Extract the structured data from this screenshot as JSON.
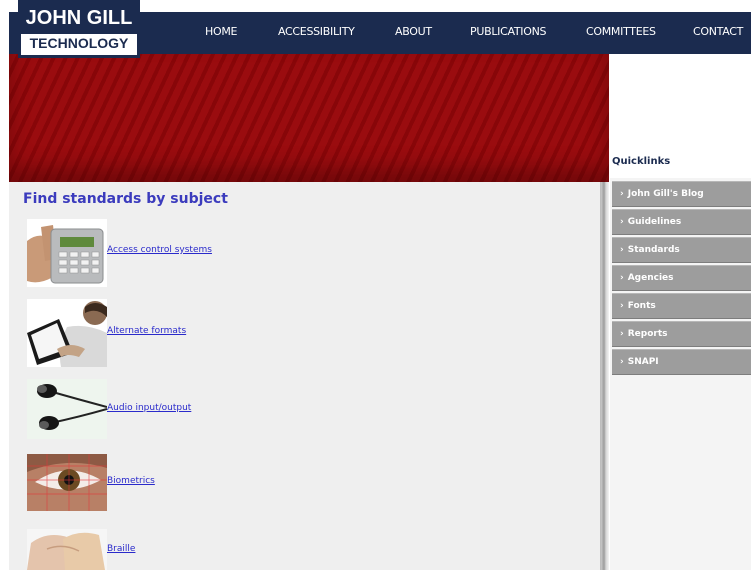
{
  "logo": {
    "line1": "JOHN GILL",
    "line2": "TECHNOLOGY"
  },
  "nav": {
    "items": [
      {
        "label": "HOME"
      },
      {
        "label": "ACCESSIBILITY"
      },
      {
        "label": "ABOUT"
      },
      {
        "label": "PUBLICATIONS"
      },
      {
        "label": "COMMITTEES"
      },
      {
        "label": "CONTACT"
      }
    ]
  },
  "content": {
    "title": "Find standards by subject",
    "subjects": [
      {
        "label": "Access control systems",
        "image": "keypad-photo"
      },
      {
        "label": "Alternate formats",
        "image": "reading-person-photo"
      },
      {
        "label": "Audio input/output",
        "image": "earphones-photo"
      },
      {
        "label": "Biometrics",
        "image": "eye-scan-photo"
      },
      {
        "label": "Braille",
        "image": "braille-fingers-photo"
      }
    ]
  },
  "sidebar": {
    "title": "Quicklinks",
    "links": [
      {
        "label": "John Gill's Blog"
      },
      {
        "label": "Guidelines"
      },
      {
        "label": "Standards"
      },
      {
        "label": "Agencies"
      },
      {
        "label": "Fonts"
      },
      {
        "label": "Reports"
      },
      {
        "label": "SNAPI"
      }
    ]
  },
  "colors": {
    "header_navy": "#1b2b4f",
    "banner_red": "#9a0c0f",
    "link_blue": "#2a2acb",
    "title_blue": "#3b3bbd",
    "quicklink_gray": "#9d9d9d"
  }
}
